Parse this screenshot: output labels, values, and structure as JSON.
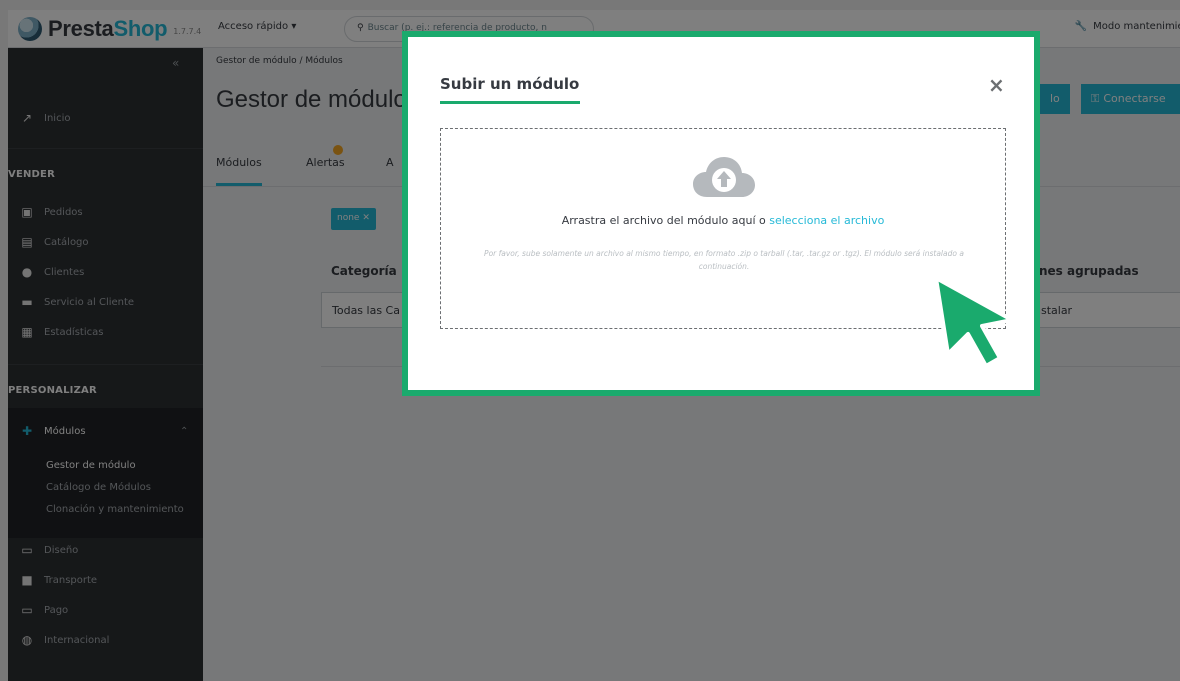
{
  "header": {
    "logo_text_1": "Presta",
    "logo_text_2": "Shop",
    "version": "1.7.7.4",
    "quick_access": "Acceso rápido ▾",
    "search_placeholder": "Buscar (p. ej.: referencia de producto, n",
    "maintenance": "Modo mantenimiento"
  },
  "sidebar": {
    "collapse_icon": "double-chevron-left-icon",
    "inicio": "Inicio",
    "section_vender": "VENDER",
    "vender_items": [
      "Pedidos",
      "Catálogo",
      "Clientes",
      "Servicio al Cliente",
      "Estadísticas"
    ],
    "section_personalizar": "PERSONALIZAR",
    "modulos": "Módulos",
    "modulos_sub": [
      "Gestor de módulo",
      "Catálogo de Módulos",
      "Clonación y mantenimiento"
    ],
    "other_items": [
      "Diseño",
      "Transporte",
      "Pago",
      "Internacional"
    ]
  },
  "content": {
    "breadcrumb": "Gestor de módulo  /  Módulos",
    "page_title": "Gestor de módulo",
    "btn_upload_tail": "lo",
    "btn_connect": "Conectarse",
    "tabs": [
      "Módulos",
      "Alertas",
      "A"
    ],
    "chip": "none ✕",
    "category_label": "Categoría",
    "category_value": "Todas las Ca",
    "group_label": "nes agrupadas",
    "group_value": "nstalar"
  },
  "modal": {
    "title": "Subir un módulo",
    "close": "×",
    "drop_text": "Arrastra el archivo del módulo aquí o ",
    "drop_link": "selecciona el archivo",
    "hint": "Por favor, sube solamente un archivo al mismo tiempo, en formato .zip o tarball (.tar, .tar.gz or .tgz). El módulo será instalado a continuación."
  },
  "colors": {
    "accent": "#25b9d7",
    "highlight_green": "#1aaa6d",
    "sidebar_bg": "#2d3033"
  }
}
